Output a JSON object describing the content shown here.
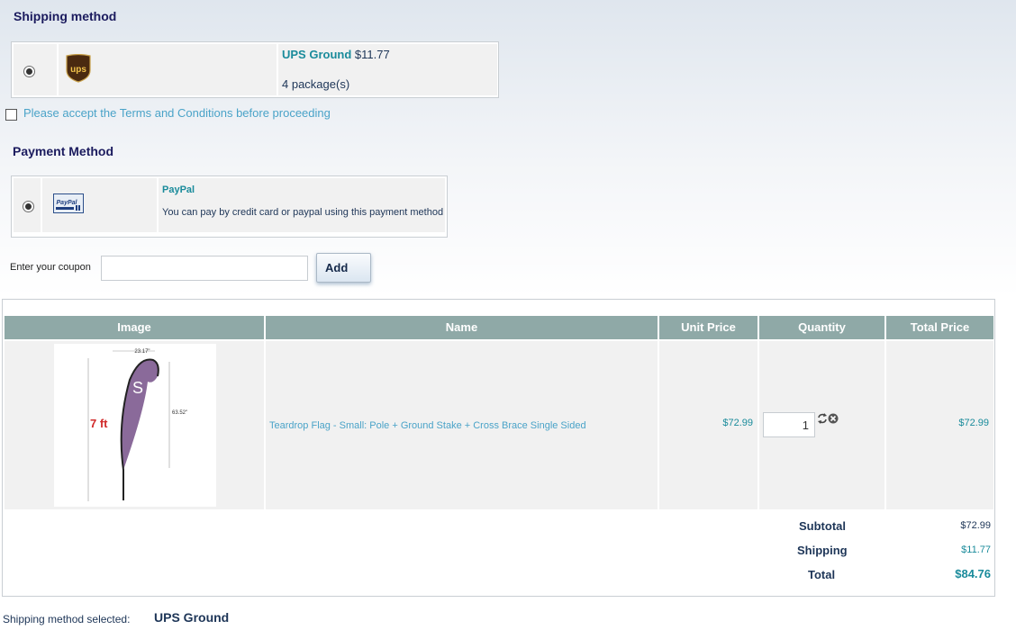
{
  "shipping": {
    "heading": "Shipping method",
    "carrier": "UPS Ground",
    "price": "$11.77",
    "packages": "4 package(s)",
    "logo_text": "ups"
  },
  "terms": {
    "label": "Please accept the Terms and Conditions before proceeding"
  },
  "payment": {
    "heading": "Payment Method",
    "name": "PayPal",
    "description": "You can pay by credit card or paypal using this payment method",
    "logo_text": "PayPal"
  },
  "coupon": {
    "label": "Enter your coupon",
    "value": "",
    "button": "Add"
  },
  "cart": {
    "columns": [
      "Image",
      "Name",
      "Unit Price",
      "Quantity",
      "Total Price"
    ],
    "items": [
      {
        "name": "Teardrop Flag - Small: Pole + Ground Stake + Cross Brace Single Sided",
        "unit_price": "$72.99",
        "quantity": "1",
        "total_price": "$72.99",
        "image": {
          "width_label": "23.17\"",
          "height_label": "63.52\"",
          "pole_label": "7 ft",
          "letter": "S"
        }
      }
    ],
    "subtotal_label": "Subtotal",
    "subtotal": "$72.99",
    "shipping_label": "Shipping",
    "shipping": "$11.77",
    "total_label": "Total",
    "total": "$84.76"
  },
  "footer": {
    "label": "Shipping method selected:",
    "value": "UPS Ground"
  },
  "colors": {
    "header_bg": "#8fa9a7",
    "accent": "#1a8b9b",
    "heading": "#1b1b5e"
  }
}
